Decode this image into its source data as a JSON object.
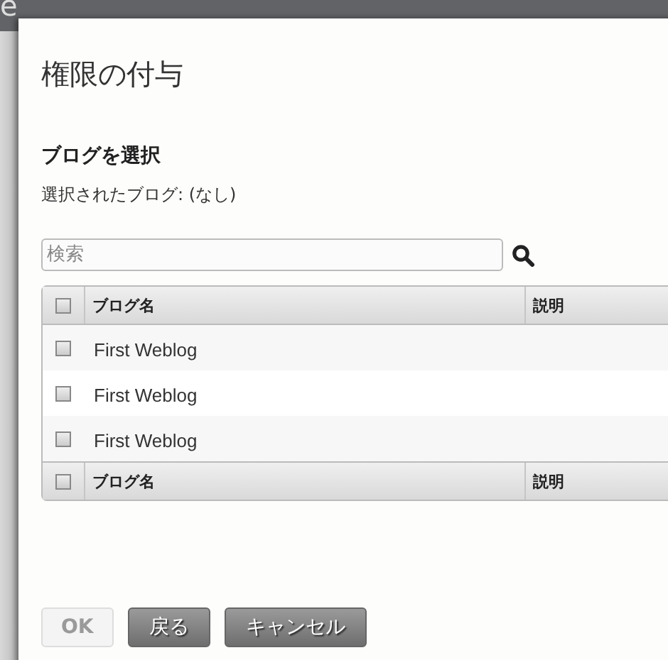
{
  "background": {
    "title": "e"
  },
  "dialog": {
    "title": "権限の付与",
    "section_heading": "ブログを選択",
    "selection": "選択されたブログ: (なし)",
    "search": {
      "placeholder": "検索"
    },
    "table": {
      "header": {
        "checked": false,
        "columns": [
          "ブログ名",
          "説明"
        ]
      },
      "rows": [
        {
          "name": "First Weblog",
          "checked": false
        },
        {
          "name": "First Weblog",
          "checked": false
        },
        {
          "name": "First Weblog",
          "checked": false
        }
      ],
      "footer": {
        "checked": false,
        "columns": [
          "ブログ名",
          "説明"
        ]
      }
    },
    "buttons": [
      {
        "label": "OK",
        "disabled": true
      },
      {
        "label": "戻る",
        "disabled": false
      },
      {
        "label": "キャンセル",
        "disabled": false
      }
    ]
  }
}
